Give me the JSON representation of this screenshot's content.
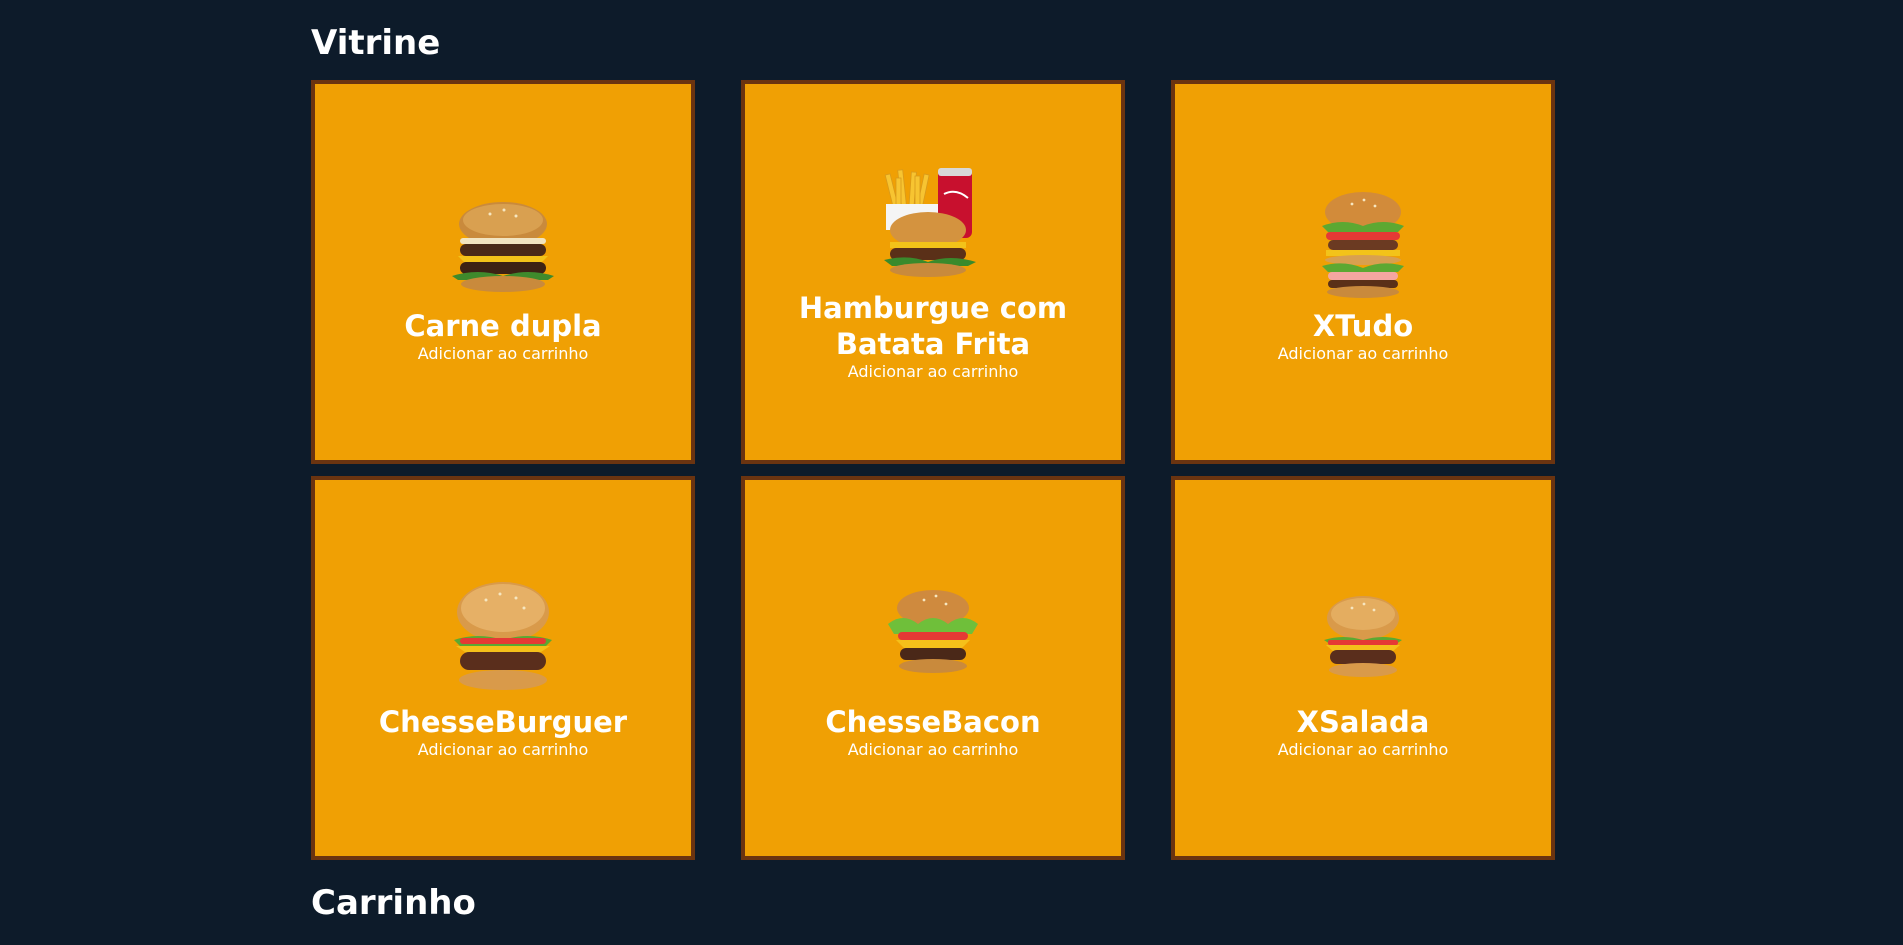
{
  "sections": {
    "vitrine_title": "Vitrine",
    "cart_title": "Carrinho"
  },
  "colors": {
    "background": "#0d1b2a",
    "card": "#f0a004",
    "card_border": "#6b3410",
    "text": "#ffffff"
  },
  "products": [
    {
      "name": "Carne dupla",
      "action": "Adicionar ao carrinho",
      "icon": "double-burger-image"
    },
    {
      "name": "Hamburgue com Batata Frita",
      "action": "Adicionar ao carrinho",
      "icon": "burger-fries-soda-image"
    },
    {
      "name": "XTudo",
      "action": "Adicionar ao carrinho",
      "icon": "xtudo-burger-image"
    },
    {
      "name": "ChesseBurguer",
      "action": "Adicionar ao carrinho",
      "icon": "cheeseburger-image"
    },
    {
      "name": "ChesseBacon",
      "action": "Adicionar ao carrinho",
      "icon": "cheese-bacon-burger-image"
    },
    {
      "name": "XSalada",
      "action": "Adicionar ao carrinho",
      "icon": "xsalada-burger-image"
    }
  ]
}
